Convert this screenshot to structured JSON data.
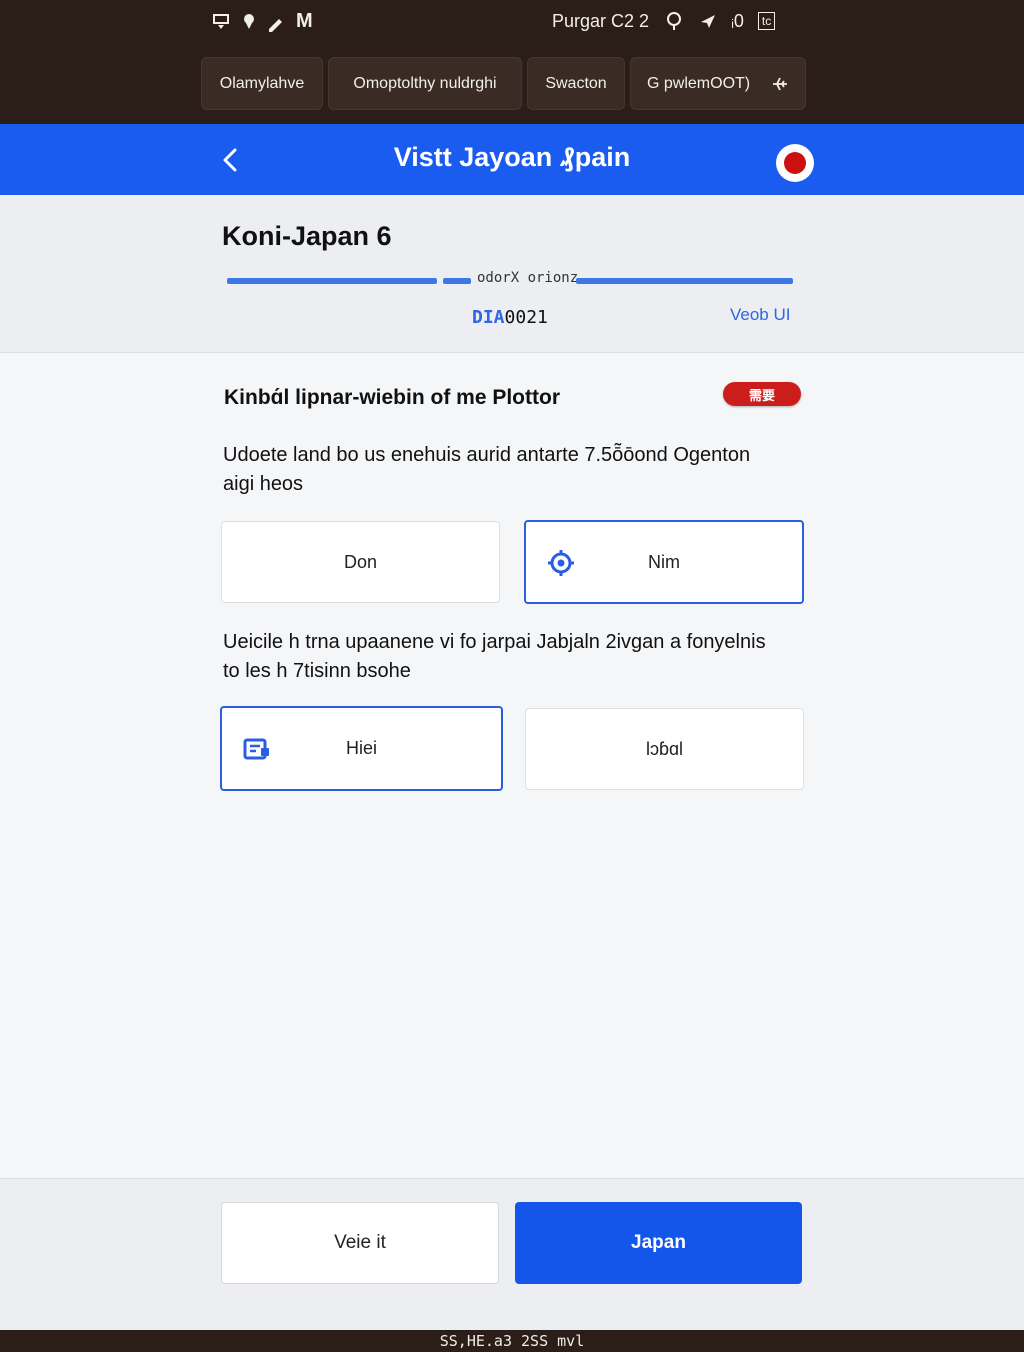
{
  "status_bar": {
    "left_glyph": "M",
    "carrier": "Purgar C2 2",
    "signal_text": "ᵢ0",
    "battery_text": "tc"
  },
  "tabs": [
    {
      "label": "Olamylahve"
    },
    {
      "label": "Omoptolthy nuldrghi"
    },
    {
      "label": "Swacton"
    },
    {
      "label": "G pwlemOOT)"
    }
  ],
  "header": {
    "title": "Vistt Jayoan ₰pain"
  },
  "summary": {
    "title": "Koni-Japan 6",
    "progress_label": "odorX orionz",
    "progress": 0.5,
    "code_prefix": "DIA",
    "code_value": "0021",
    "view_link": "Veob UI"
  },
  "main": {
    "section_title": "Kinbɑ́l lipnar-wiebin of me Plottor",
    "badge": "需要",
    "question1": "Udoete land bo us enehuis aurid antarte 7.5ō̃ōond Ogenton aigi heos",
    "question2": "Ueicile h trna upaanene vi fo jarpai Jabjaln 2ivgan a fonyelnis to les h 7tisinn bsohe",
    "options_q1": [
      {
        "label": "Don",
        "selected": false
      },
      {
        "label": "Nim",
        "selected": true,
        "icon": "gear-icon"
      }
    ],
    "options_q2": [
      {
        "label": "Hiei",
        "selected": true,
        "icon": "card-icon"
      },
      {
        "label": "Ɩɔɓɑl",
        "selected": false
      }
    ]
  },
  "footer": {
    "secondary_label": "Veie it",
    "primary_label": "Japan"
  },
  "bottom_strip": {
    "text": "SS,HE.a3 2SS mvl"
  },
  "colors": {
    "accent": "#1a5cf0",
    "primary_button": "#1456ea",
    "badge": "#cc1d1d",
    "dark_bg": "#2b1d17"
  }
}
